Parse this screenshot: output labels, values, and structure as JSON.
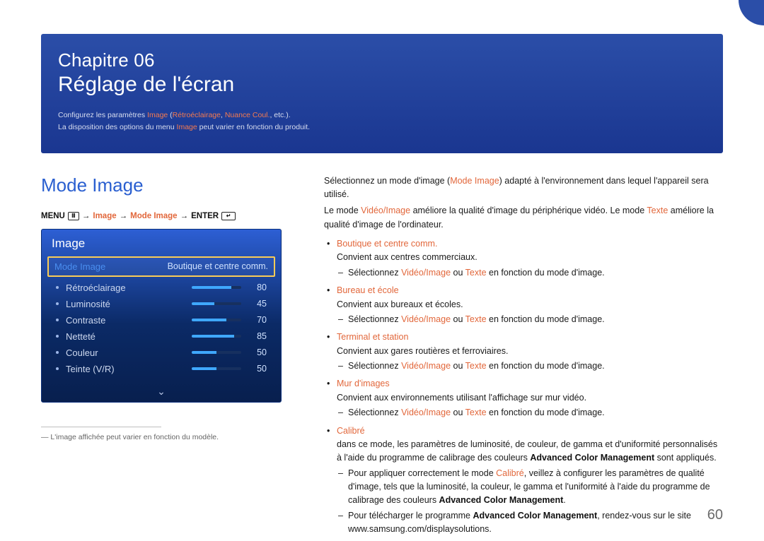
{
  "page_number": "60",
  "chapter": {
    "line1": "Chapitre 06",
    "line2": "Réglage de l'écran",
    "desc_pre": "Configurez les paramètres ",
    "desc_hl1": "Image",
    "desc_mid1": " (",
    "desc_hl2": "Rétroéclairage",
    "desc_mid2": ", ",
    "desc_hl3": "Nuance Coul.",
    "desc_post": ", etc.).",
    "desc2_pre": "La disposition des options du menu ",
    "desc2_hl": "Image",
    "desc2_post": " peut varier en fonction du produit."
  },
  "left": {
    "section_title": "Mode Image",
    "bc_menu": "MENU",
    "bc_arrow": "→",
    "bc_image": "Image",
    "bc_mode": "Mode Image",
    "bc_enter": "ENTER",
    "panel_title": "Image",
    "sel_label": "Mode Image",
    "sel_value": "Boutique et centre comm.",
    "rows": [
      {
        "name": "Rétroéclairage",
        "value": 80
      },
      {
        "name": "Luminosité",
        "value": 45
      },
      {
        "name": "Contraste",
        "value": 70
      },
      {
        "name": "Netteté",
        "value": 85
      },
      {
        "name": "Couleur",
        "value": 50
      },
      {
        "name": "Teinte (V/R)",
        "value": 50
      }
    ],
    "more_glyph": "⌄",
    "footnote_dash": "―",
    "footnote": "L'image affichée peut varier en fonction du modèle."
  },
  "right": {
    "p1_pre": "Sélectionnez un mode d'image (",
    "p1_hl": "Mode Image",
    "p1_post": ") adapté à l'environnement dans lequel l'appareil sera utilisé.",
    "p2_pre": "Le mode ",
    "p2_hl1": "Vidéo/Image",
    "p2_mid": " améliore la qualité d'image du périphérique vidéo. Le mode ",
    "p2_hl2": "Texte",
    "p2_post": " améliore la qualité d'image de l'ordinateur.",
    "items": [
      {
        "head": "Boutique et centre comm.",
        "desc": "Convient aux centres commerciaux.",
        "sub_pre": "Sélectionnez ",
        "sub_hl1": "Vidéo/Image",
        "sub_mid": " ou ",
        "sub_hl2": "Texte",
        "sub_post": " en fonction du mode d'image."
      },
      {
        "head": "Bureau et école",
        "desc": "Convient aux bureaux et écoles.",
        "sub_pre": "Sélectionnez ",
        "sub_hl1": "Vidéo/Image",
        "sub_mid": " ou ",
        "sub_hl2": "Texte",
        "sub_post": " en fonction du mode d'image."
      },
      {
        "head": "Terminal et station",
        "desc": "Convient aux gares routières et ferroviaires.",
        "sub_pre": "Sélectionnez ",
        "sub_hl1": "Vidéo/Image",
        "sub_mid": " ou ",
        "sub_hl2": "Texte",
        "sub_post": " en fonction du mode d'image."
      },
      {
        "head": "Mur d'images",
        "desc": "Convient aux environnements utilisant l'affichage sur mur vidéo.",
        "sub_pre": "Sélectionnez ",
        "sub_hl1": "Vidéo/Image",
        "sub_mid": " ou ",
        "sub_hl2": "Texte",
        "sub_post": " en fonction du mode d'image."
      }
    ],
    "calibre": {
      "head": "Calibré",
      "desc_pre": "dans ce mode, les paramètres de luminosité, de couleur, de gamma et d'uniformité personnalisés à l'aide du programme de calibrage des couleurs ",
      "desc_acm": "Advanced Color Management",
      "desc_post": " sont appliqués.",
      "sub1_pre": "Pour appliquer correctement le mode ",
      "sub1_hl": "Calibré",
      "sub1_mid": ", veillez à configurer les paramètres de qualité d'image, tels que la luminosité, la couleur, le gamma et l'uniformité à l'aide du programme de calibrage des couleurs ",
      "sub1_acm": "Advanced Color Management",
      "sub1_post": ".",
      "sub2_pre": "Pour télécharger le programme ",
      "sub2_acm": "Advanced Color Management",
      "sub2_post": ", rendez-vous sur le site www.samsung.com/displaysolutions."
    }
  }
}
